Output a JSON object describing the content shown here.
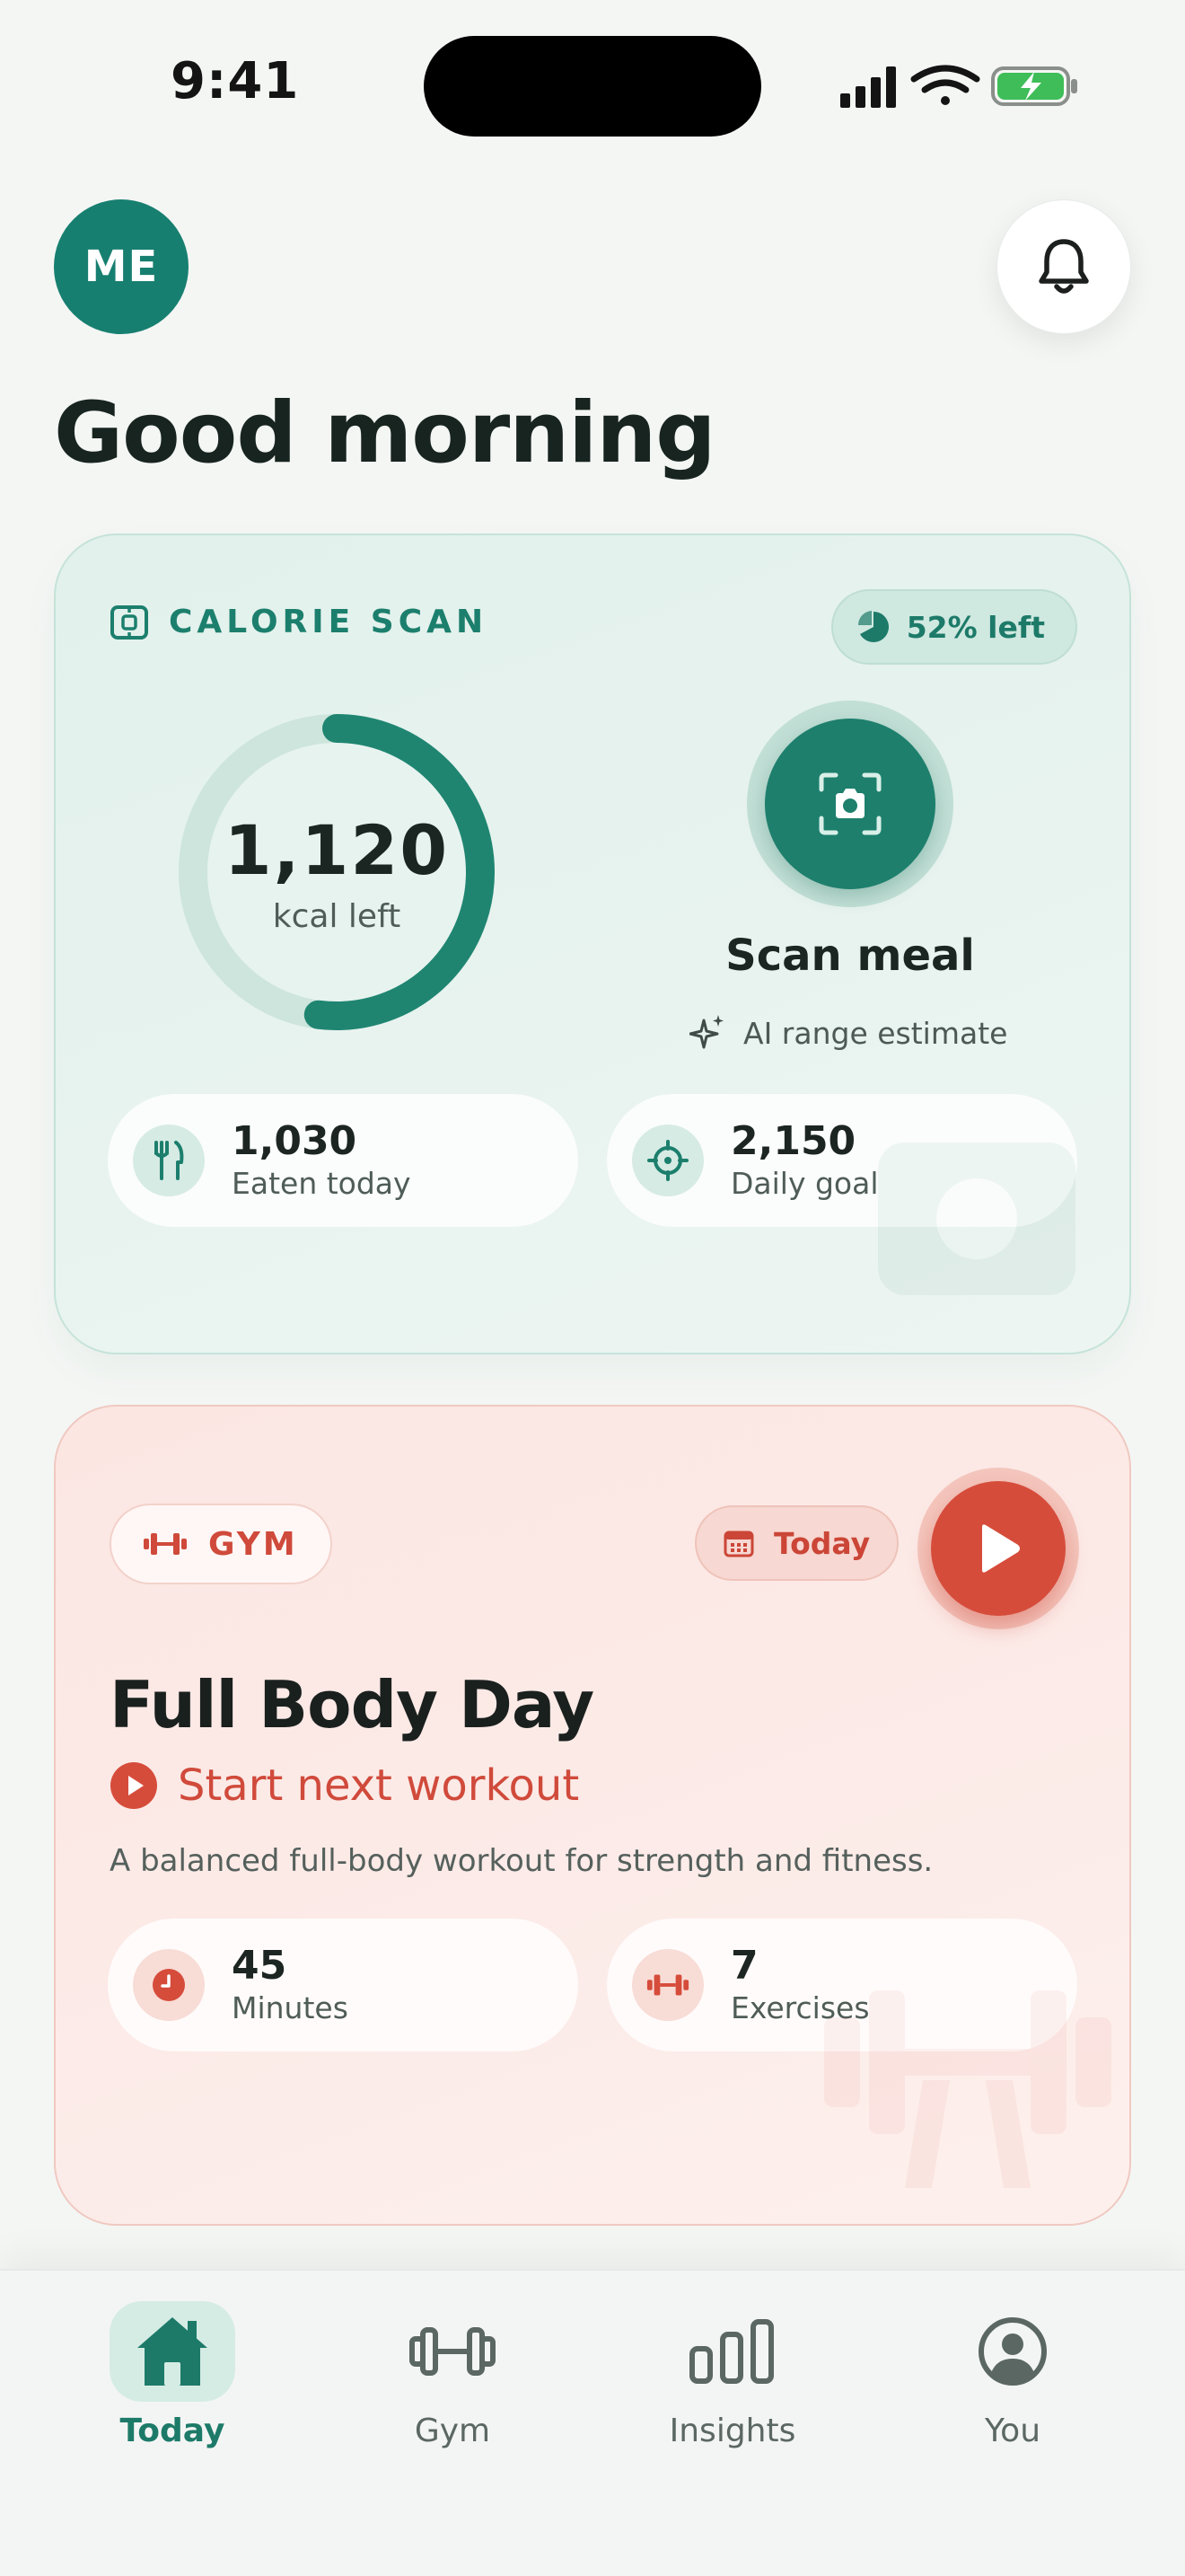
{
  "status": {
    "time": "9:41"
  },
  "header": {
    "avatar_initials": "ME",
    "greeting": "Good morning"
  },
  "calorie": {
    "tag": "CALORIE SCAN",
    "badge": "52% left",
    "ring_value": "1,120",
    "ring_unit": "kcal left",
    "remaining_fraction": 0.52,
    "scan_label": "Scan meal",
    "scan_sub": "AI range estimate",
    "eaten_value": "1,030",
    "eaten_label": "Eaten today",
    "goal_value": "2,150",
    "goal_label": "Daily goal"
  },
  "gym": {
    "tag": "GYM",
    "today": "Today",
    "title": "Full Body Day",
    "start": "Start next workout",
    "description": "A balanced full-body workout for strength and fitness.",
    "minutes_value": "45",
    "minutes_label": "Minutes",
    "exercises_value": "7",
    "exercises_label": "Exercises"
  },
  "nav": {
    "today": "Today",
    "gym": "Gym",
    "insights": "Insights",
    "you": "You"
  },
  "colors": {
    "teal": "#1e7f6d",
    "coral": "#d64c3b"
  }
}
